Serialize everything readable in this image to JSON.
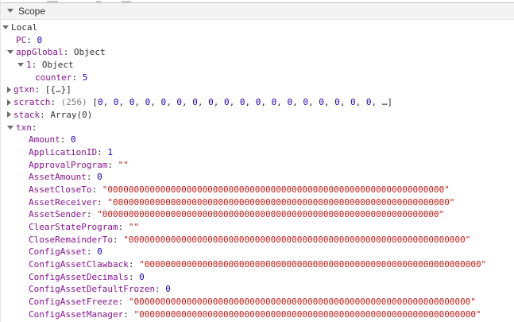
{
  "colors": {
    "key_purple": "#881391",
    "number_blue": "#1c00cf",
    "string_red": "#c41a16",
    "array_count_gray": "#808080",
    "default_text": "#303030",
    "header_bg": "#f3f3f3"
  },
  "panel": {
    "header": {
      "title": "Scope"
    },
    "tree": {
      "rows": [
        {
          "id": "local",
          "pad": 2,
          "exp": "open",
          "seg": [
            {
              "t": "Local",
              "c": "d"
            }
          ]
        },
        {
          "id": "pc",
          "pad": 19,
          "exp": null,
          "seg": [
            {
              "t": "PC",
              "c": "k"
            },
            {
              "t": ": ",
              "c": "d"
            },
            {
              "t": "0",
              "c": "n"
            }
          ]
        },
        {
          "id": "appglobal",
          "pad": 8,
          "exp": "open",
          "seg": [
            {
              "t": "appGlobal",
              "c": "k"
            },
            {
              "t": ": ",
              "c": "d"
            },
            {
              "t": "Object",
              "c": "d"
            }
          ]
        },
        {
          "id": "appglobal-1",
          "pad": 21,
          "exp": "open",
          "seg": [
            {
              "t": "1",
              "c": "k"
            },
            {
              "t": ": ",
              "c": "d"
            },
            {
              "t": "Object",
              "c": "d"
            }
          ]
        },
        {
          "id": "counter",
          "pad": 43,
          "exp": null,
          "seg": [
            {
              "t": "counter",
              "c": "k"
            },
            {
              "t": ": ",
              "c": "d"
            },
            {
              "t": "5",
              "c": "n"
            }
          ]
        },
        {
          "id": "gtxn",
          "pad": 8,
          "exp": "closed",
          "seg": [
            {
              "t": "gtxn",
              "c": "k"
            },
            {
              "t": ": ",
              "c": "d"
            },
            {
              "t": "[{…}]",
              "c": "d"
            }
          ]
        },
        {
          "id": "scratch",
          "pad": 8,
          "exp": "closed",
          "seg": [
            {
              "t": "scratch",
              "c": "k"
            },
            {
              "t": ": ",
              "c": "d"
            },
            {
              "t": "(256) ",
              "c": "g"
            },
            {
              "t": "[",
              "c": "d"
            },
            {
              "t": "0",
              "c": "n"
            },
            {
              "t": ", ",
              "c": "d"
            },
            {
              "t": "0",
              "c": "n"
            },
            {
              "t": ", ",
              "c": "d"
            },
            {
              "t": "0",
              "c": "n"
            },
            {
              "t": ", ",
              "c": "d"
            },
            {
              "t": "0",
              "c": "n"
            },
            {
              "t": ", ",
              "c": "d"
            },
            {
              "t": "0",
              "c": "n"
            },
            {
              "t": ", ",
              "c": "d"
            },
            {
              "t": "0",
              "c": "n"
            },
            {
              "t": ", ",
              "c": "d"
            },
            {
              "t": "0",
              "c": "n"
            },
            {
              "t": ", ",
              "c": "d"
            },
            {
              "t": "0",
              "c": "n"
            },
            {
              "t": ", ",
              "c": "d"
            },
            {
              "t": "0",
              "c": "n"
            },
            {
              "t": ", ",
              "c": "d"
            },
            {
              "t": "0",
              "c": "n"
            },
            {
              "t": ", ",
              "c": "d"
            },
            {
              "t": "0",
              "c": "n"
            },
            {
              "t": ", ",
              "c": "d"
            },
            {
              "t": "0",
              "c": "n"
            },
            {
              "t": ", ",
              "c": "d"
            },
            {
              "t": "0",
              "c": "n"
            },
            {
              "t": ", ",
              "c": "d"
            },
            {
              "t": "0",
              "c": "n"
            },
            {
              "t": ", ",
              "c": "d"
            },
            {
              "t": "0",
              "c": "n"
            },
            {
              "t": ", ",
              "c": "d"
            },
            {
              "t": "0",
              "c": "n"
            },
            {
              "t": ", ",
              "c": "d"
            },
            {
              "t": "0",
              "c": "n"
            },
            {
              "t": ", ",
              "c": "d"
            },
            {
              "t": "0",
              "c": "n"
            },
            {
              "t": ", ",
              "c": "d"
            },
            {
              "t": "…]",
              "c": "d"
            }
          ]
        },
        {
          "id": "stack",
          "pad": 8,
          "exp": "closed",
          "seg": [
            {
              "t": "stack",
              "c": "k"
            },
            {
              "t": ": ",
              "c": "d"
            },
            {
              "t": "Array(0)",
              "c": "d"
            }
          ]
        },
        {
          "id": "txn",
          "pad": 8,
          "exp": "open",
          "seg": [
            {
              "t": "txn",
              "c": "k"
            },
            {
              "t": ":",
              "c": "d"
            }
          ]
        },
        {
          "id": "amount",
          "pad": 35,
          "exp": null,
          "seg": [
            {
              "t": "Amount",
              "c": "k"
            },
            {
              "t": ": ",
              "c": "d"
            },
            {
              "t": "0",
              "c": "n"
            }
          ]
        },
        {
          "id": "applicationid",
          "pad": 35,
          "exp": null,
          "seg": [
            {
              "t": "ApplicationID",
              "c": "k"
            },
            {
              "t": ": ",
              "c": "d"
            },
            {
              "t": "1",
              "c": "n"
            }
          ]
        },
        {
          "id": "approvalprogram",
          "pad": 35,
          "exp": null,
          "seg": [
            {
              "t": "ApprovalProgram",
              "c": "k"
            },
            {
              "t": ": ",
              "c": "d"
            },
            {
              "t": "\"\"",
              "c": "s"
            }
          ]
        },
        {
          "id": "assetamount",
          "pad": 35,
          "exp": null,
          "seg": [
            {
              "t": "AssetAmount",
              "c": "k"
            },
            {
              "t": ": ",
              "c": "d"
            },
            {
              "t": "0",
              "c": "n"
            }
          ]
        },
        {
          "id": "assetcloseto",
          "pad": 35,
          "exp": null,
          "seg": [
            {
              "t": "AssetCloseTo",
              "c": "k"
            },
            {
              "t": ": ",
              "c": "d"
            },
            {
              "t": "\"0000000000000000000000000000000000000000000000000000000000000000\"",
              "c": "s"
            }
          ]
        },
        {
          "id": "assetreceiver",
          "pad": 35,
          "exp": null,
          "seg": [
            {
              "t": "AssetReceiver",
              "c": "k"
            },
            {
              "t": ": ",
              "c": "d"
            },
            {
              "t": "\"0000000000000000000000000000000000000000000000000000000000000000\"",
              "c": "s"
            }
          ]
        },
        {
          "id": "assetsender",
          "pad": 35,
          "exp": null,
          "seg": [
            {
              "t": "AssetSender",
              "c": "k"
            },
            {
              "t": ": ",
              "c": "d"
            },
            {
              "t": "\"0000000000000000000000000000000000000000000000000000000000000000\"",
              "c": "s"
            }
          ]
        },
        {
          "id": "clearstateprogram",
          "pad": 35,
          "exp": null,
          "seg": [
            {
              "t": "ClearStateProgram",
              "c": "k"
            },
            {
              "t": ": ",
              "c": "d"
            },
            {
              "t": "\"\"",
              "c": "s"
            }
          ]
        },
        {
          "id": "closeremainderto",
          "pad": 35,
          "exp": null,
          "seg": [
            {
              "t": "CloseRemainderTo",
              "c": "k"
            },
            {
              "t": ": ",
              "c": "d"
            },
            {
              "t": "\"0000000000000000000000000000000000000000000000000000000000000000\"",
              "c": "s"
            }
          ]
        },
        {
          "id": "configasset",
          "pad": 35,
          "exp": null,
          "seg": [
            {
              "t": "ConfigAsset",
              "c": "k"
            },
            {
              "t": ": ",
              "c": "d"
            },
            {
              "t": "0",
              "c": "n"
            }
          ]
        },
        {
          "id": "configassetclawback",
          "pad": 35,
          "exp": null,
          "seg": [
            {
              "t": "ConfigAssetClawback",
              "c": "k"
            },
            {
              "t": ": ",
              "c": "d"
            },
            {
              "t": "\"0000000000000000000000000000000000000000000000000000000000000000\"",
              "c": "s"
            }
          ]
        },
        {
          "id": "configassetdecimals",
          "pad": 35,
          "exp": null,
          "seg": [
            {
              "t": "ConfigAssetDecimals",
              "c": "k"
            },
            {
              "t": ": ",
              "c": "d"
            },
            {
              "t": "0",
              "c": "n"
            }
          ]
        },
        {
          "id": "configassetdefaultfrozen",
          "pad": 35,
          "exp": null,
          "seg": [
            {
              "t": "ConfigAssetDefaultFrozen",
              "c": "k"
            },
            {
              "t": ": ",
              "c": "d"
            },
            {
              "t": "0",
              "c": "n"
            }
          ]
        },
        {
          "id": "configassetfreeze",
          "pad": 35,
          "exp": null,
          "seg": [
            {
              "t": "ConfigAssetFreeze",
              "c": "k"
            },
            {
              "t": ": ",
              "c": "d"
            },
            {
              "t": "\"0000000000000000000000000000000000000000000000000000000000000000\"",
              "c": "s"
            }
          ]
        },
        {
          "id": "configassetmanager",
          "pad": 35,
          "exp": null,
          "seg": [
            {
              "t": "ConfigAssetManager",
              "c": "k"
            },
            {
              "t": ": ",
              "c": "d"
            },
            {
              "t": "\"0000000000000000000000000000000000000000000000000000000000000000\"",
              "c": "s"
            }
          ]
        }
      ]
    }
  }
}
